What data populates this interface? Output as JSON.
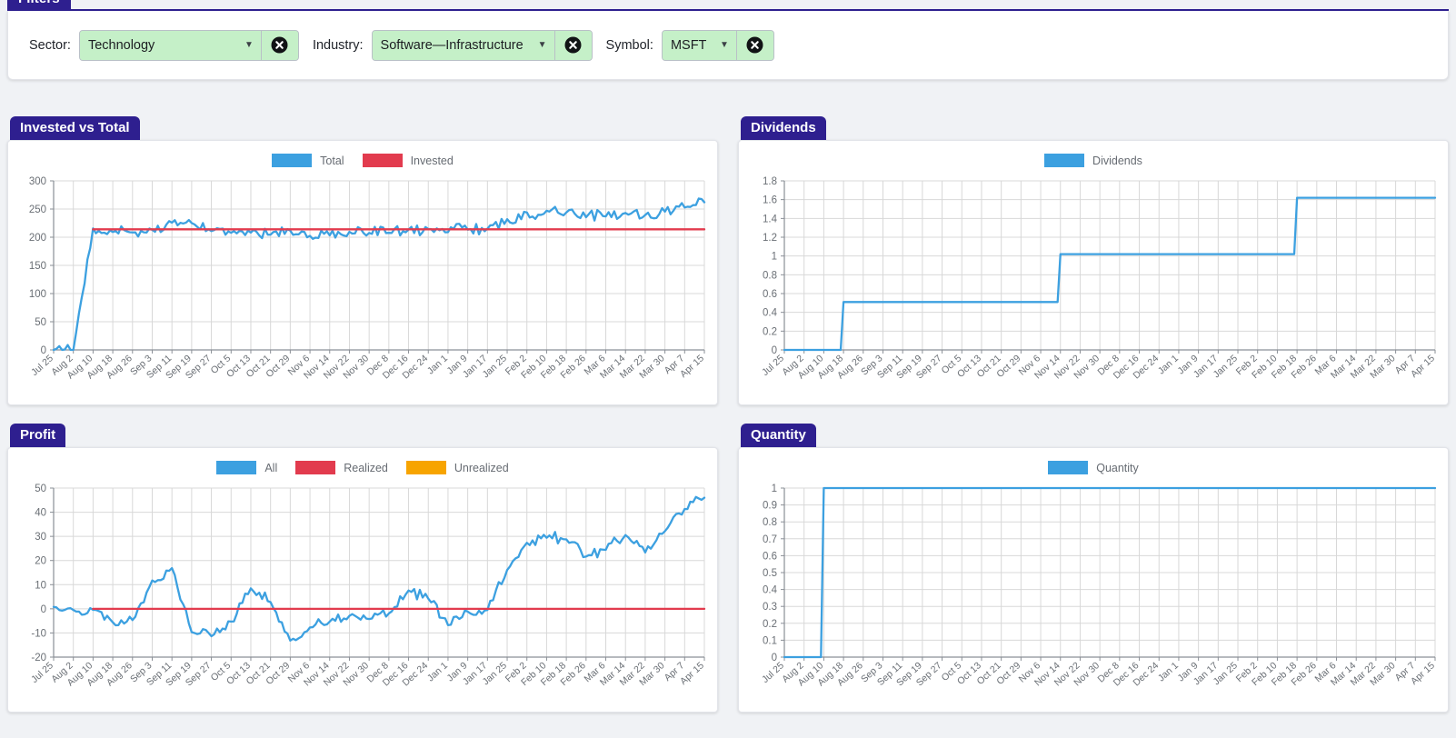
{
  "filters": {
    "tab_label": "Filters",
    "sector": {
      "label": "Sector:",
      "value": "Technology",
      "clear_icon": "clear-circle-icon"
    },
    "industry": {
      "label": "Industry:",
      "value": "Software—Infrastructure",
      "clear_icon": "clear-circle-icon"
    },
    "symbol": {
      "label": "Symbol:",
      "value": "MSFT",
      "clear_icon": "clear-circle-icon"
    }
  },
  "colors": {
    "header": "#2e1f8f",
    "blue": "#3ca0e0",
    "red": "#e23b4e",
    "orange": "#f7a400",
    "select_bg": "#c5f0c8",
    "grid": "#d8d8d8",
    "axis": "#8a8f96",
    "page_bg": "#f0f2f5"
  },
  "panels": [
    {
      "title": "Invested vs Total"
    },
    {
      "title": "Dividends"
    },
    {
      "title": "Profit"
    },
    {
      "title": "Quantity"
    }
  ],
  "x_ticks": [
    "Jul 25",
    "Aug 2",
    "Aug 10",
    "Aug 18",
    "Aug 26",
    "Sep 3",
    "Sep 11",
    "Sep 19",
    "Sep 27",
    "Oct 5",
    "Oct 13",
    "Oct 21",
    "Oct 29",
    "Nov 6",
    "Nov 14",
    "Nov 22",
    "Nov 30",
    "Dec 8",
    "Dec 16",
    "Dec 24",
    "Jan 1",
    "Jan 9",
    "Jan 17",
    "Jan 25",
    "Feb 2",
    "Feb 10",
    "Feb 18",
    "Feb 26",
    "Mar 6",
    "Mar 14",
    "Mar 22",
    "Mar 30",
    "Apr 7",
    "Apr 15"
  ],
  "chart_data": [
    {
      "type": "line",
      "title": "Invested vs Total",
      "xlabel": "",
      "ylabel": "",
      "ylim": [
        0,
        300
      ],
      "yticks": [
        0,
        50,
        100,
        150,
        200,
        250,
        300
      ],
      "grid": true,
      "legend_position": "top-center",
      "x": [
        "Jul 25",
        "Aug 2",
        "Aug 10",
        "Aug 18",
        "Aug 26",
        "Sep 3",
        "Sep 11",
        "Sep 19",
        "Sep 27",
        "Oct 5",
        "Oct 13",
        "Oct 21",
        "Oct 29",
        "Nov 6",
        "Nov 14",
        "Nov 22",
        "Nov 30",
        "Dec 8",
        "Dec 16",
        "Dec 24",
        "Jan 1",
        "Jan 9",
        "Jan 17",
        "Jan 25",
        "Feb 2",
        "Feb 10",
        "Feb 18",
        "Feb 26",
        "Mar 6",
        "Mar 14",
        "Mar 22",
        "Mar 30",
        "Apr 7",
        "Apr 15"
      ],
      "series": [
        {
          "name": "Total",
          "color": "#3ca0e0",
          "values": [
            0,
            0,
            213,
            211,
            209,
            213,
            225,
            227,
            213,
            208,
            209,
            207,
            211,
            203,
            205,
            207,
            209,
            211,
            213,
            212,
            211,
            216,
            214,
            230,
            241,
            245,
            243,
            238,
            240,
            244,
            239,
            247,
            256,
            262
          ]
        },
        {
          "name": "Invested",
          "color": "#e23b4e",
          "values": [
            null,
            null,
            214,
            214,
            214,
            214,
            214,
            214,
            214,
            214,
            214,
            214,
            214,
            214,
            214,
            214,
            214,
            214,
            214,
            214,
            214,
            214,
            214,
            214,
            214,
            214,
            214,
            214,
            214,
            214,
            214,
            214,
            214,
            214
          ]
        }
      ]
    },
    {
      "type": "line",
      "title": "Dividends",
      "xlabel": "",
      "ylabel": "",
      "ylim": [
        0,
        1.8
      ],
      "yticks": [
        0,
        0.2,
        0.4,
        0.6,
        0.8,
        1.0,
        1.2,
        1.4,
        1.6,
        1.8
      ],
      "grid": true,
      "legend_position": "top-center",
      "x": [
        "Jul 25",
        "Aug 2",
        "Aug 10",
        "Aug 18",
        "Aug 26",
        "Sep 3",
        "Sep 11",
        "Sep 19",
        "Sep 27",
        "Oct 5",
        "Oct 13",
        "Oct 21",
        "Oct 29",
        "Nov 6",
        "Nov 14",
        "Nov 22",
        "Nov 30",
        "Dec 8",
        "Dec 16",
        "Dec 24",
        "Jan 1",
        "Jan 9",
        "Jan 17",
        "Jan 25",
        "Feb 2",
        "Feb 10",
        "Feb 18",
        "Feb 26",
        "Mar 6",
        "Mar 14",
        "Mar 22",
        "Mar 30",
        "Apr 7",
        "Apr 15"
      ],
      "series": [
        {
          "name": "Dividends",
          "color": "#3ca0e0",
          "values": [
            0,
            0,
            0,
            0.51,
            0.51,
            0.51,
            0.51,
            0.51,
            0.51,
            0.51,
            0.51,
            0.51,
            0.51,
            0.51,
            1.02,
            1.02,
            1.02,
            1.02,
            1.02,
            1.02,
            1.02,
            1.02,
            1.02,
            1.02,
            1.02,
            1.02,
            1.62,
            1.62,
            1.62,
            1.62,
            1.62,
            1.62,
            1.62,
            1.62
          ]
        }
      ],
      "steps": [
        {
          "date": "Aug 18",
          "value": 0.51
        },
        {
          "date": "Nov 16",
          "value": 1.02
        },
        {
          "date": "Feb 18",
          "value": 1.62
        }
      ]
    },
    {
      "type": "line",
      "title": "Profit",
      "xlabel": "",
      "ylabel": "",
      "ylim": [
        -20,
        50
      ],
      "yticks": [
        -20,
        -10,
        0,
        10,
        20,
        30,
        40,
        50
      ],
      "grid": true,
      "legend_position": "top-center",
      "x": [
        "Jul 25",
        "Aug 2",
        "Aug 10",
        "Aug 18",
        "Aug 26",
        "Sep 3",
        "Sep 11",
        "Sep 19",
        "Sep 27",
        "Oct 5",
        "Oct 13",
        "Oct 21",
        "Oct 29",
        "Nov 6",
        "Nov 14",
        "Nov 22",
        "Nov 30",
        "Dec 8",
        "Dec 16",
        "Dec 24",
        "Jan 1",
        "Jan 9",
        "Jan 17",
        "Jan 25",
        "Feb 2",
        "Feb 10",
        "Feb 18",
        "Feb 26",
        "Mar 6",
        "Mar 14",
        "Mar 22",
        "Mar 30",
        "Apr 7",
        "Apr 15"
      ],
      "series": [
        {
          "name": "All",
          "color": "#3ca0e0",
          "values": [
            0,
            0,
            -1,
            -6,
            -4,
            11,
            17,
            -9,
            -11,
            -6,
            9,
            3,
            -13,
            -7,
            -5,
            -3,
            -4,
            -2,
            7,
            5,
            -6,
            -1,
            0,
            16,
            27,
            30,
            29,
            21,
            25,
            30,
            24,
            32,
            42,
            46
          ]
        },
        {
          "name": "Realized",
          "color": "#e23b4e",
          "values": [
            null,
            null,
            0,
            0,
            0,
            0,
            0,
            0,
            0,
            0,
            0,
            0,
            0,
            0,
            0,
            0,
            0,
            0,
            0,
            0,
            0,
            0,
            0,
            0,
            0,
            0,
            0,
            0,
            0,
            0,
            0,
            0,
            0,
            0
          ]
        },
        {
          "name": "Unrealized",
          "color": "#f7a400",
          "values": []
        }
      ]
    },
    {
      "type": "line",
      "title": "Quantity",
      "xlabel": "",
      "ylabel": "",
      "ylim": [
        0,
        1.0
      ],
      "yticks": [
        0,
        0.1,
        0.2,
        0.3,
        0.4,
        0.5,
        0.6,
        0.7,
        0.8,
        0.9,
        1.0
      ],
      "grid": true,
      "legend_position": "top-center",
      "x": [
        "Jul 25",
        "Aug 2",
        "Aug 10",
        "Aug 18",
        "Aug 26",
        "Sep 3",
        "Sep 11",
        "Sep 19",
        "Sep 27",
        "Oct 5",
        "Oct 13",
        "Oct 21",
        "Oct 29",
        "Nov 6",
        "Nov 14",
        "Nov 22",
        "Nov 30",
        "Dec 8",
        "Dec 16",
        "Dec 24",
        "Jan 1",
        "Jan 9",
        "Jan 17",
        "Jan 25",
        "Feb 2",
        "Feb 10",
        "Feb 18",
        "Feb 26",
        "Mar 6",
        "Mar 14",
        "Mar 22",
        "Mar 30",
        "Apr 7",
        "Apr 15"
      ],
      "series": [
        {
          "name": "Quantity",
          "color": "#3ca0e0",
          "values": [
            0,
            0,
            1,
            1,
            1,
            1,
            1,
            1,
            1,
            1,
            1,
            1,
            1,
            1,
            1,
            1,
            1,
            1,
            1,
            1,
            1,
            1,
            1,
            1,
            1,
            1,
            1,
            1,
            1,
            1,
            1,
            1,
            1,
            1
          ]
        }
      ],
      "steps": [
        {
          "date": "Aug 2",
          "value": 1.0
        }
      ]
    }
  ]
}
